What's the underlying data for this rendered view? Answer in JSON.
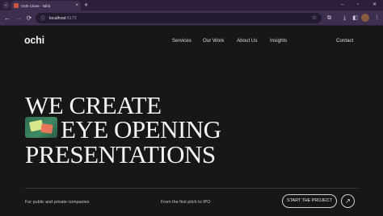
{
  "browser": {
    "tab": {
      "title": "Ochi Clone - Nihit",
      "close_icon": "close-icon",
      "favicon": "site-favicon"
    },
    "tab_search_icon": "chevron-down-icon",
    "new_tab_icon": "plus-icon",
    "window_controls": {
      "minimize": "–",
      "maximize": "▫",
      "close": "✕"
    },
    "nav": {
      "back": "←",
      "forward": "→",
      "reload": "⟳"
    },
    "address": {
      "host": "localhost",
      "rest": ":5173",
      "icon": "ⓘ",
      "bookmark_icon": "☆"
    },
    "toolbar_icons": {
      "extensions": "⧉",
      "download": "⤓",
      "sidebar": "◧",
      "menu": "⋮"
    }
  },
  "site": {
    "logo": "ochi",
    "nav": [
      "Services",
      "Our Work",
      "About Us",
      "Insights",
      "Contact"
    ]
  },
  "hero": {
    "lines": [
      "WE CREATE",
      "EYE OPENING",
      "PRESENTATIONS"
    ]
  },
  "footer": {
    "left": "For public and private companies",
    "middle": "From the first pitch to IPO",
    "cta_label": "START THE PROJECT",
    "cta_arrow": "↗"
  }
}
